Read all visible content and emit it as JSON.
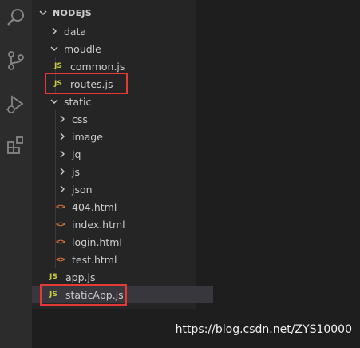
{
  "explorer": {
    "root": "NODEJS",
    "items": [
      {
        "label": "data",
        "type": "folder",
        "expanded": false
      },
      {
        "label": "moudle",
        "type": "folder",
        "expanded": true
      },
      {
        "label": "common.js",
        "type": "js"
      },
      {
        "label": "routes.js",
        "type": "js"
      },
      {
        "label": "static",
        "type": "folder",
        "expanded": true
      },
      {
        "label": "css",
        "type": "folder",
        "expanded": false
      },
      {
        "label": "image",
        "type": "folder",
        "expanded": false
      },
      {
        "label": "jq",
        "type": "folder",
        "expanded": false
      },
      {
        "label": "js",
        "type": "folder",
        "expanded": false
      },
      {
        "label": "json",
        "type": "folder",
        "expanded": false
      },
      {
        "label": "404.html",
        "type": "html"
      },
      {
        "label": "index.html",
        "type": "html"
      },
      {
        "label": "login.html",
        "type": "html"
      },
      {
        "label": "test.html",
        "type": "html"
      },
      {
        "label": "app.js",
        "type": "js"
      },
      {
        "label": "staticApp.js",
        "type": "js",
        "selected": true
      }
    ],
    "js_badge": "JS",
    "html_badge": "<>"
  },
  "watermark": "https://blog.csdn.net/ZYS10000",
  "colors": {
    "highlight_border": "#e53935",
    "js_icon": "#cbcb41",
    "html_icon": "#e37933"
  },
  "icons": [
    "search-icon",
    "source-control-icon",
    "run-debug-icon",
    "extensions-icon"
  ]
}
